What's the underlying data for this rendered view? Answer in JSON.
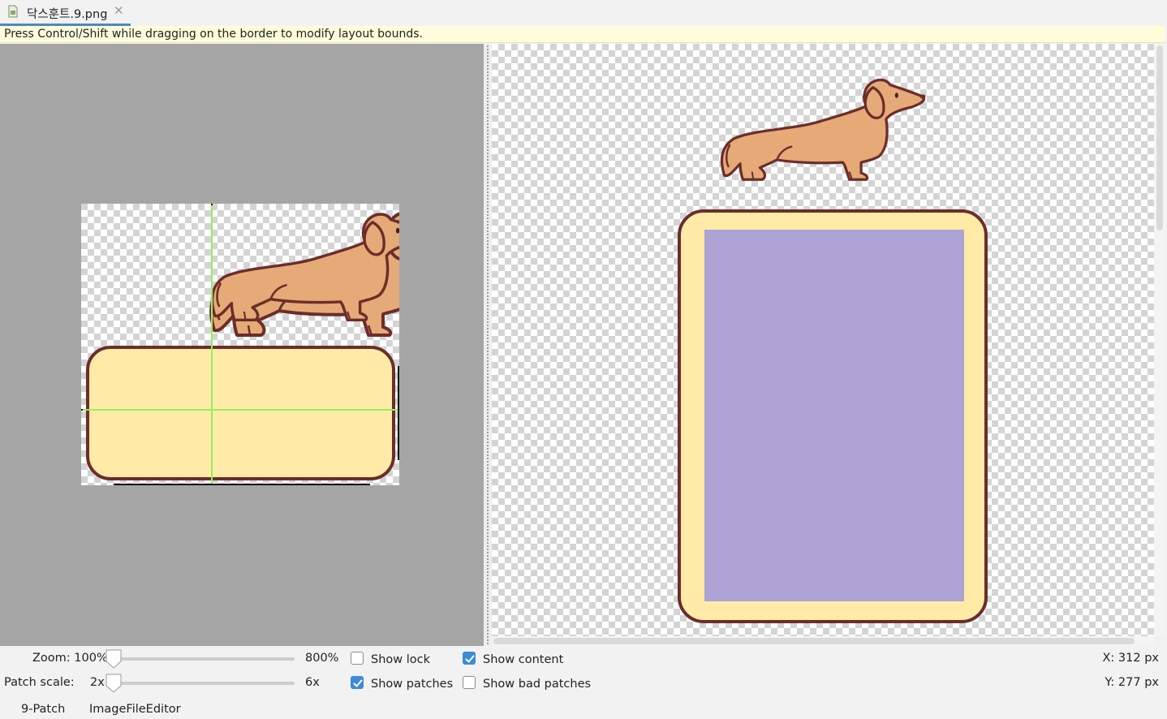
{
  "tab": {
    "title": "닥스훈트.9.png",
    "close_glyph": "✕",
    "icon": "image-file-icon"
  },
  "hint": {
    "text": "Press Control/Shift while dragging on the border to modify layout bounds."
  },
  "controls": {
    "zoom_label": "Zoom: 100%",
    "zoom_max": "800%",
    "zoom_value": 0,
    "patch_scale_label": "Patch scale:",
    "patch_scale_min": "2x",
    "patch_scale_max": "6x",
    "patch_scale_value": 0,
    "show_lock": {
      "label": "Show lock",
      "checked": false
    },
    "show_patches": {
      "label": "Show patches",
      "checked": true
    },
    "show_content": {
      "label": "Show content",
      "checked": true
    },
    "show_bad_patches": {
      "label": "Show bad patches",
      "checked": false
    },
    "x_readout": "X: 312 px",
    "y_readout": "Y: 277 px"
  },
  "bottom_tabs": [
    "9-Patch",
    "ImageFileEditor"
  ],
  "colors": {
    "editor_bg": "#a5a5a5",
    "box_fill": "#ffeaa8",
    "box_outline": "#6b2e2a",
    "dog_fill": "#e6a978",
    "patch_guide": "#8ff25d",
    "content_area": "#ada3d5",
    "accent": "#3d8ad6"
  }
}
